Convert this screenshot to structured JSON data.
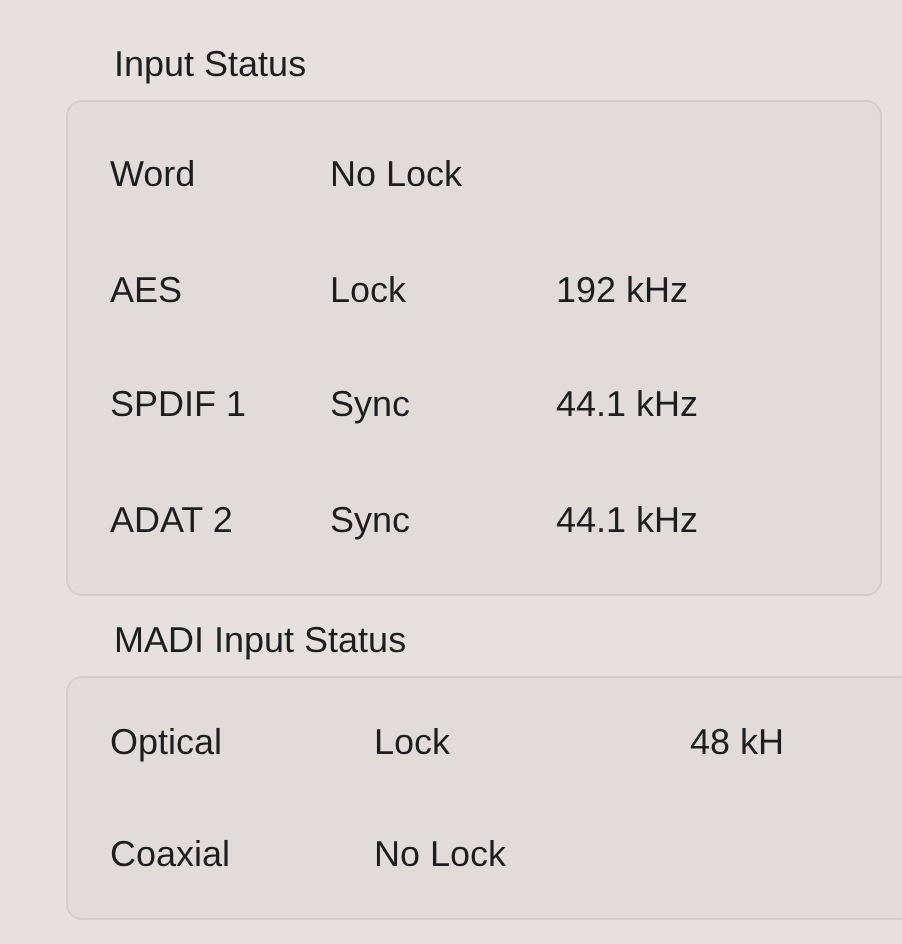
{
  "sections": [
    {
      "title": "Input Status",
      "kind": "narrow",
      "rows": [
        {
          "name": "Word",
          "status": "No Lock",
          "rate": ""
        },
        {
          "name": "AES",
          "status": "Lock",
          "rate": "192 kHz"
        },
        {
          "name": "SPDIF 1",
          "status": "Sync",
          "rate": "44.1 kHz"
        },
        {
          "name": "ADAT 2",
          "status": "Sync",
          "rate": "44.1 kHz"
        }
      ]
    },
    {
      "title": "MADI Input Status",
      "kind": "wide",
      "rows": [
        {
          "name": "Optical",
          "status": "Lock",
          "rate": "48 kH"
        },
        {
          "name": "Coaxial",
          "status": "No Lock",
          "rate": ""
        }
      ]
    }
  ]
}
